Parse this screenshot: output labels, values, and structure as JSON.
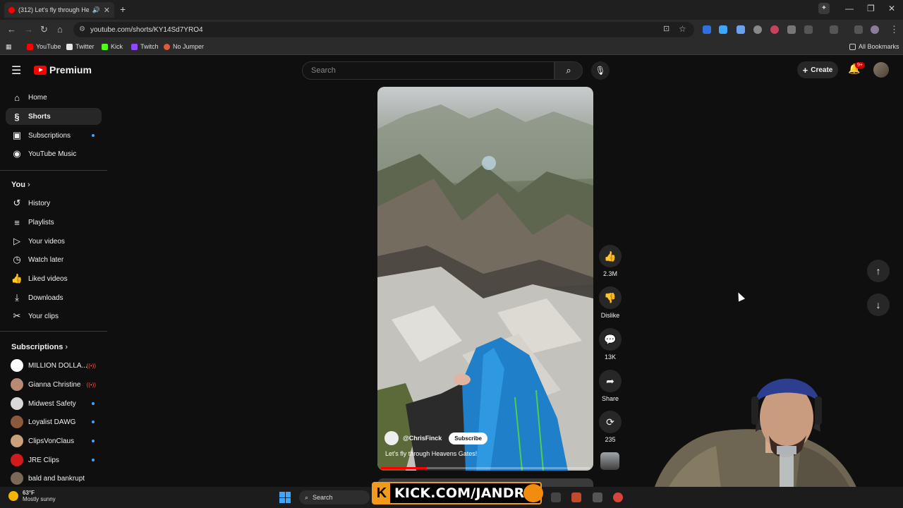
{
  "browser": {
    "tab_title": "(312) Let's fly through Hea",
    "url": "youtube.com/shorts/KY14Sd7YRO4",
    "bookmarks": [
      {
        "label": "YouTube",
        "color": "#ff0000"
      },
      {
        "label": "Twitter",
        "color": "#e7e7e7"
      },
      {
        "label": "Kick",
        "color": "#53fc18"
      },
      {
        "label": "Twitch",
        "color": "#9146ff"
      },
      {
        "label": "No Jumper",
        "color": "#e05a3a"
      }
    ],
    "all_bookmarks": "All Bookmarks"
  },
  "header": {
    "brand": "Premium",
    "search_placeholder": "Search",
    "create_label": "Create",
    "notification_count": "9+"
  },
  "sidebar": {
    "main": [
      {
        "label": "Home",
        "icon": "home-icon"
      },
      {
        "label": "Shorts",
        "icon": "shorts-icon"
      },
      {
        "label": "Subscriptions",
        "icon": "subscriptions-icon"
      },
      {
        "label": "YouTube Music",
        "icon": "music-icon"
      }
    ],
    "you_heading": "You",
    "you": [
      {
        "label": "History",
        "icon": "history-icon"
      },
      {
        "label": "Playlists",
        "icon": "playlists-icon"
      },
      {
        "label": "Your videos",
        "icon": "your-videos-icon"
      },
      {
        "label": "Watch later",
        "icon": "watch-later-icon"
      },
      {
        "label": "Liked videos",
        "icon": "liked-icon"
      },
      {
        "label": "Downloads",
        "icon": "download-icon"
      },
      {
        "label": "Your clips",
        "icon": "clips-icon"
      }
    ],
    "subscriptions_heading": "Subscriptions",
    "subscriptions": [
      {
        "label": "MILLION DOLLA...",
        "badge": "live",
        "color": "#ffffff"
      },
      {
        "label": "Gianna Christine",
        "badge": "live",
        "color": "#b98a73"
      },
      {
        "label": "Midwest Safety",
        "badge": "dot",
        "color": "#d8d8d8"
      },
      {
        "label": "Loyalist DAWG",
        "badge": "dot",
        "color": "#8b5a3c"
      },
      {
        "label": "ClipsVonClaus",
        "badge": "dot",
        "color": "#c9a27a"
      },
      {
        "label": "JRE Clips",
        "badge": "dot",
        "color": "#d11a1a"
      },
      {
        "label": "bald and bankrupt",
        "badge": "",
        "color": "#7a6a55"
      }
    ]
  },
  "short": {
    "channel": "@ChrisFinck",
    "subscribe_label": "Subscribe",
    "caption": "Let's fly through Heavens Gates!",
    "progress": 0.22,
    "actions": [
      {
        "icon": "like-icon",
        "glyph": "👍",
        "label": "2.3M"
      },
      {
        "icon": "dislike-icon",
        "glyph": "👎",
        "label": "Dislike"
      },
      {
        "icon": "comment-icon",
        "glyph": "💬",
        "label": "13K"
      },
      {
        "icon": "share-icon",
        "glyph": "➦",
        "label": "Share"
      },
      {
        "icon": "remix-icon",
        "glyph": "⟳",
        "label": "235"
      }
    ]
  },
  "taskbar": {
    "temp": "63°F",
    "weather": "Mostly sunny",
    "search_label": "Search"
  },
  "overlay": {
    "kick_text": "KICK.COM/JANDRO"
  }
}
